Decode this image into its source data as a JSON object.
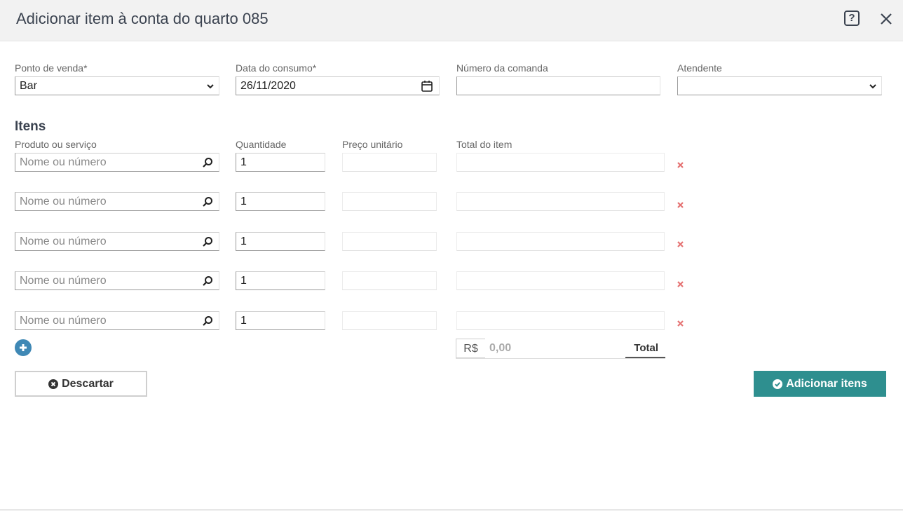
{
  "dialog": {
    "title": "Adicionar item à conta do quarto 085",
    "help_icon": "question-mark-icon",
    "close_icon": "close-icon"
  },
  "header_fields": {
    "point_of_sale": {
      "label": "Ponto de venda*",
      "value": "Bar"
    },
    "consumption_date": {
      "label": "Data do consumo*",
      "value": "26/11/2020"
    },
    "order_number": {
      "label": "Número da comanda",
      "value": ""
    },
    "attendant": {
      "label": "Atendente",
      "value": ""
    }
  },
  "items": {
    "section_title": "Itens",
    "columns": {
      "product": "Produto ou serviço",
      "quantity": "Quantidade",
      "unit_price": "Preço unitário",
      "item_total": "Total do item"
    },
    "product_placeholder": "Nome ou número",
    "rows": [
      {
        "quantity": "1",
        "unit_price": "",
        "item_total": ""
      },
      {
        "quantity": "1",
        "unit_price": "",
        "item_total": ""
      },
      {
        "quantity": "1",
        "unit_price": "",
        "item_total": ""
      },
      {
        "quantity": "1",
        "unit_price": "",
        "item_total": ""
      },
      {
        "quantity": "1",
        "unit_price": "",
        "item_total": ""
      }
    ]
  },
  "totals": {
    "currency": "R$",
    "value": "0,00",
    "label": "Total"
  },
  "actions": {
    "discard_label": "Descartar",
    "submit_label": "Adicionar itens"
  },
  "colors": {
    "accent": "#2e8f8f",
    "add_button": "#3f88b5",
    "remove_icon": "#e57373"
  }
}
